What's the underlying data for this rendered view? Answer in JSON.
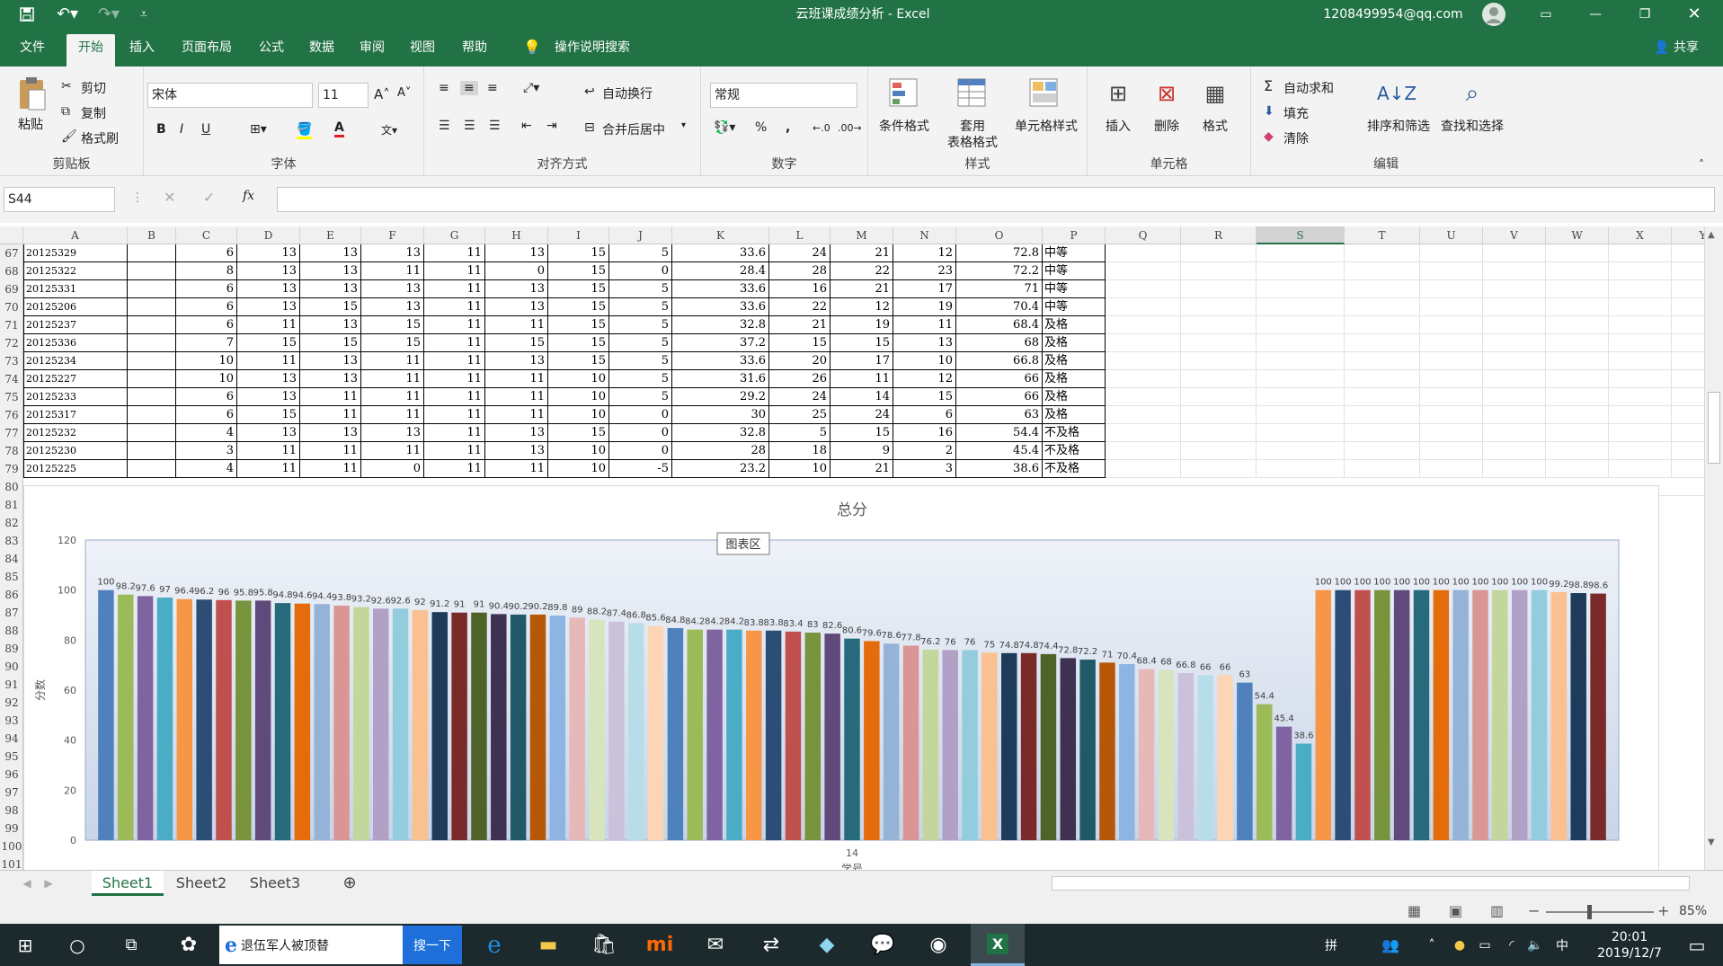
{
  "titlebar": {
    "doc_title": "云班课成绩分析 - Excel",
    "account": "1208499954@qq.com"
  },
  "tabs": [
    "文件",
    "开始",
    "插入",
    "页面布局",
    "公式",
    "数据",
    "审阅",
    "视图",
    "帮助"
  ],
  "tell_me": "操作说明搜索",
  "share": "共享",
  "ribbon": {
    "clipboard": {
      "paste": "粘贴",
      "cut": "剪切",
      "copy": "复制",
      "format_painter": "格式刷",
      "label": "剪贴板"
    },
    "font": {
      "name": "宋体",
      "size": "11",
      "label": "字体",
      "bold": "B",
      "italic": "I",
      "underline": "U"
    },
    "alignment": {
      "wrap": "自动换行",
      "merge": "合并后居中",
      "label": "对齐方式"
    },
    "number": {
      "format": "常规",
      "percent": "%",
      "comma": ",",
      "label": "数字"
    },
    "styles": {
      "conditional": "条件格式",
      "table_1": "套用",
      "table_2": "表格格式",
      "cell_styles": "单元格样式",
      "label": "样式"
    },
    "cells": {
      "insert": "插入",
      "delete": "删除",
      "format": "格式",
      "label": "单元格"
    },
    "editing": {
      "autosum": "自动求和",
      "fill": "填充",
      "clear": "清除",
      "sort": "排序和筛选",
      "find": "查找和选择",
      "label": "编辑"
    }
  },
  "formula_bar": {
    "name_box": "S44",
    "fx": "fx",
    "value": ""
  },
  "columns": [
    "A",
    "B",
    "C",
    "D",
    "E",
    "F",
    "G",
    "H",
    "I",
    "J",
    "K",
    "L",
    "M",
    "N",
    "O",
    "P",
    "Q",
    "R",
    "S",
    "T",
    "U",
    "V",
    "W",
    "X",
    "Y"
  ],
  "selected_column": "S",
  "row_numbers": [
    "67",
    "68",
    "69",
    "70",
    "71",
    "72",
    "73",
    "74",
    "75",
    "76",
    "77",
    "78",
    "79",
    "80",
    "81",
    "82",
    "83",
    "84",
    "85",
    "86",
    "87",
    "88",
    "89",
    "90",
    "91",
    "92",
    "93",
    "94",
    "95",
    "96",
    "97",
    "98",
    "99",
    "100",
    "101"
  ],
  "rows": [
    [
      "20125329",
      "",
      "6",
      "13",
      "13",
      "13",
      "11",
      "13",
      "15",
      "5",
      "33.6",
      "24",
      "21",
      "12",
      "72.8",
      "中等"
    ],
    [
      "20125322",
      "",
      "8",
      "13",
      "13",
      "11",
      "11",
      "0",
      "15",
      "0",
      "28.4",
      "28",
      "22",
      "23",
      "72.2",
      "中等"
    ],
    [
      "20125331",
      "",
      "6",
      "13",
      "13",
      "13",
      "11",
      "13",
      "15",
      "5",
      "33.6",
      "16",
      "21",
      "17",
      "71",
      "中等"
    ],
    [
      "20125206",
      "",
      "6",
      "13",
      "15",
      "13",
      "11",
      "13",
      "15",
      "5",
      "33.6",
      "22",
      "12",
      "19",
      "70.4",
      "中等"
    ],
    [
      "20125237",
      "",
      "6",
      "11",
      "13",
      "15",
      "11",
      "11",
      "15",
      "5",
      "32.8",
      "21",
      "19",
      "11",
      "68.4",
      "及格"
    ],
    [
      "20125336",
      "",
      "7",
      "15",
      "15",
      "15",
      "11",
      "15",
      "15",
      "5",
      "37.2",
      "15",
      "15",
      "13",
      "68",
      "及格"
    ],
    [
      "20125234",
      "",
      "10",
      "11",
      "13",
      "11",
      "11",
      "13",
      "15",
      "5",
      "33.6",
      "20",
      "17",
      "10",
      "66.8",
      "及格"
    ],
    [
      "20125227",
      "",
      "10",
      "13",
      "13",
      "11",
      "11",
      "11",
      "10",
      "5",
      "31.6",
      "26",
      "11",
      "12",
      "66",
      "及格"
    ],
    [
      "20125233",
      "",
      "6",
      "13",
      "11",
      "11",
      "11",
      "11",
      "10",
      "5",
      "29.2",
      "24",
      "14",
      "15",
      "66",
      "及格"
    ],
    [
      "20125317",
      "",
      "6",
      "15",
      "11",
      "11",
      "11",
      "11",
      "10",
      "0",
      "30",
      "25",
      "24",
      "6",
      "63",
      "及格"
    ],
    [
      "20125232",
      "",
      "4",
      "13",
      "13",
      "13",
      "11",
      "13",
      "15",
      "0",
      "32.8",
      "5",
      "15",
      "16",
      "54.4",
      "不及格"
    ],
    [
      "20125230",
      "",
      "3",
      "11",
      "11",
      "11",
      "11",
      "13",
      "10",
      "0",
      "28",
      "18",
      "9",
      "2",
      "45.4",
      "不及格"
    ],
    [
      "20125225",
      "",
      "4",
      "11",
      "11",
      "0",
      "11",
      "11",
      "10",
      "-5",
      "23.2",
      "10",
      "21",
      "3",
      "38.6",
      "不及格"
    ]
  ],
  "chart_data": {
    "type": "bar",
    "title": "总分",
    "xlabel": "学号",
    "ylabel": "分数",
    "x_tick_label": "14",
    "tooltip": "图表区",
    "ylim": [
      0,
      120
    ],
    "yticks": [
      0,
      20,
      40,
      60,
      80,
      100,
      120
    ],
    "grid": false,
    "values": [
      100,
      98.2,
      97.6,
      97,
      96.4,
      96.2,
      96,
      95.8,
      95.8,
      94.8,
      94.6,
      94.4,
      93.8,
      93.2,
      92.6,
      92.6,
      92,
      91.2,
      91,
      91,
      90.4,
      90.2,
      90.2,
      89.8,
      89,
      88.2,
      87.4,
      86.8,
      85.6,
      84.8,
      84.2,
      84.2,
      84.2,
      83.8,
      83.8,
      83.4,
      83,
      82.6,
      80.6,
      79.6,
      78.6,
      77.8,
      76.2,
      76,
      76,
      75,
      74.8,
      74.8,
      74.4,
      72.8,
      72.2,
      71,
      70.4,
      68.4,
      68,
      66.8,
      66,
      66,
      63,
      54.4,
      45.4,
      38.6,
      100,
      100,
      100,
      100,
      100,
      100,
      100,
      100,
      100,
      100,
      100,
      100,
      99.2,
      98.8,
      98.6
    ],
    "labels": [
      "100",
      "98.2",
      "97.6",
      "97",
      "96.4",
      "96.2",
      "96",
      "95.8",
      "95.8",
      "94.8",
      "94.6",
      "94.4",
      "93.8",
      "93.2",
      "92.6",
      "92.6",
      "92",
      "91.2",
      "91",
      "91",
      "90.4",
      "90.2",
      "90.2",
      "89.8",
      "89",
      "88.2",
      "87.4",
      "86.8",
      "85.6",
      "84.8",
      "84.2",
      "84.2",
      "84.2",
      "83.8",
      "83.8",
      "83.4",
      "83",
      "82.6",
      "80.6",
      "79.6",
      "78.6",
      "77.8",
      "76.2",
      "76",
      "76",
      "75",
      "74.8",
      "74.8",
      "74.4",
      "72.8",
      "72.2",
      "71",
      "70.4",
      "68.4",
      "68",
      "66.8",
      "66",
      "66",
      "63",
      "54.4",
      "45.4",
      "38.6",
      "100",
      "100",
      "100",
      "100",
      "100",
      "100",
      "100",
      "100",
      "100",
      "100",
      "100",
      "100",
      "99.2",
      "98.8",
      "98.6"
    ],
    "colors": [
      "#4f81bd",
      "#9bbb59",
      "#8064a2",
      "#4bacc6",
      "#f79646",
      "#2c4d75",
      "#c0504d",
      "#77933c",
      "#604a7b",
      "#276a7c",
      "#e46c0a",
      "#95b3d7",
      "#d99694",
      "#c3d69b",
      "#b2a1c7",
      "#93cddd",
      "#fac090",
      "#1f3b5c",
      "#7a2b29",
      "#4f6228",
      "#3f3151",
      "#215968",
      "#b65708",
      "#8eb4e3",
      "#e6b9b8",
      "#d7e4bd",
      "#ccc1da",
      "#b7dee8",
      "#fcd5b5"
    ]
  },
  "sheets": [
    "Sheet1",
    "Sheet2",
    "Sheet3"
  ],
  "status": {
    "zoom": "85%"
  },
  "taskbar": {
    "search_text": "退伍军人被顶替",
    "search_button": "搜一下",
    "ime": "拼",
    "ime2": "中",
    "time": "20:01",
    "date": "2019/12/7"
  }
}
